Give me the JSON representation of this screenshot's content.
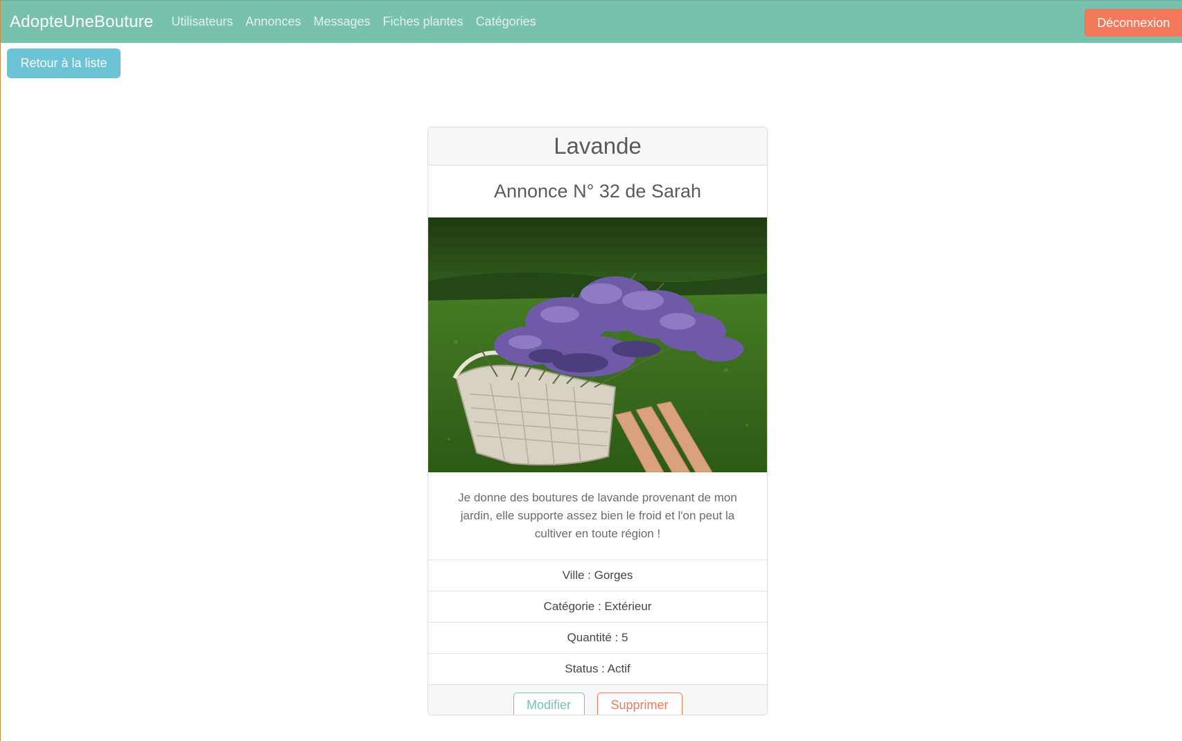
{
  "navbar": {
    "brand": "AdopteUneBouture",
    "links": [
      "Utilisateurs",
      "Annonces",
      "Messages",
      "Fiches plantes",
      "Catégories"
    ],
    "logout_label": "Déconnexion"
  },
  "back_button_label": "Retour à la liste",
  "listing": {
    "title": "Lavande",
    "subtitle": "Annonce N° 32 de Sarah",
    "description": "Je donne des boutures de lavande provenant de mon jardin, elle supporte assez bien le froid et l'on peut la cultiver en toute région !",
    "details": [
      "Ville : Gorges",
      "Catégorie : Extérieur",
      "Quantité : 5",
      "Status : Actif"
    ],
    "edit_label": "Modifier",
    "delete_label": "Supprimer"
  },
  "colors": {
    "primary": "#78c2ad",
    "danger": "#f3785b",
    "info": "#6cc3d5"
  }
}
